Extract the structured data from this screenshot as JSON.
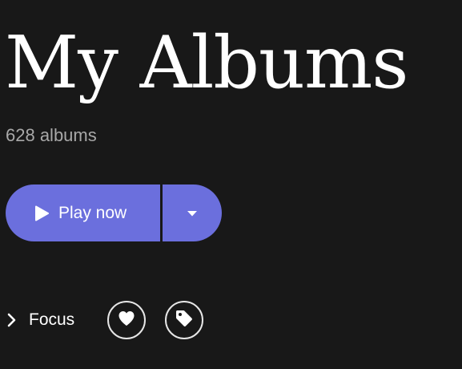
{
  "header": {
    "title": "My Albums",
    "subtitle": "628 albums"
  },
  "actions": {
    "play_label": "Play now",
    "play_icon": "play-icon",
    "dropdown_icon": "caret-down-icon",
    "focus_label": "Focus",
    "focus_icon": "chevron-right-icon",
    "favorite_icon": "heart-icon",
    "tag_icon": "tag-icon"
  },
  "colors": {
    "background": "#181818",
    "accent": "#6b6fdd",
    "text": "#ffffff",
    "muted_text": "#a8a8a8"
  }
}
